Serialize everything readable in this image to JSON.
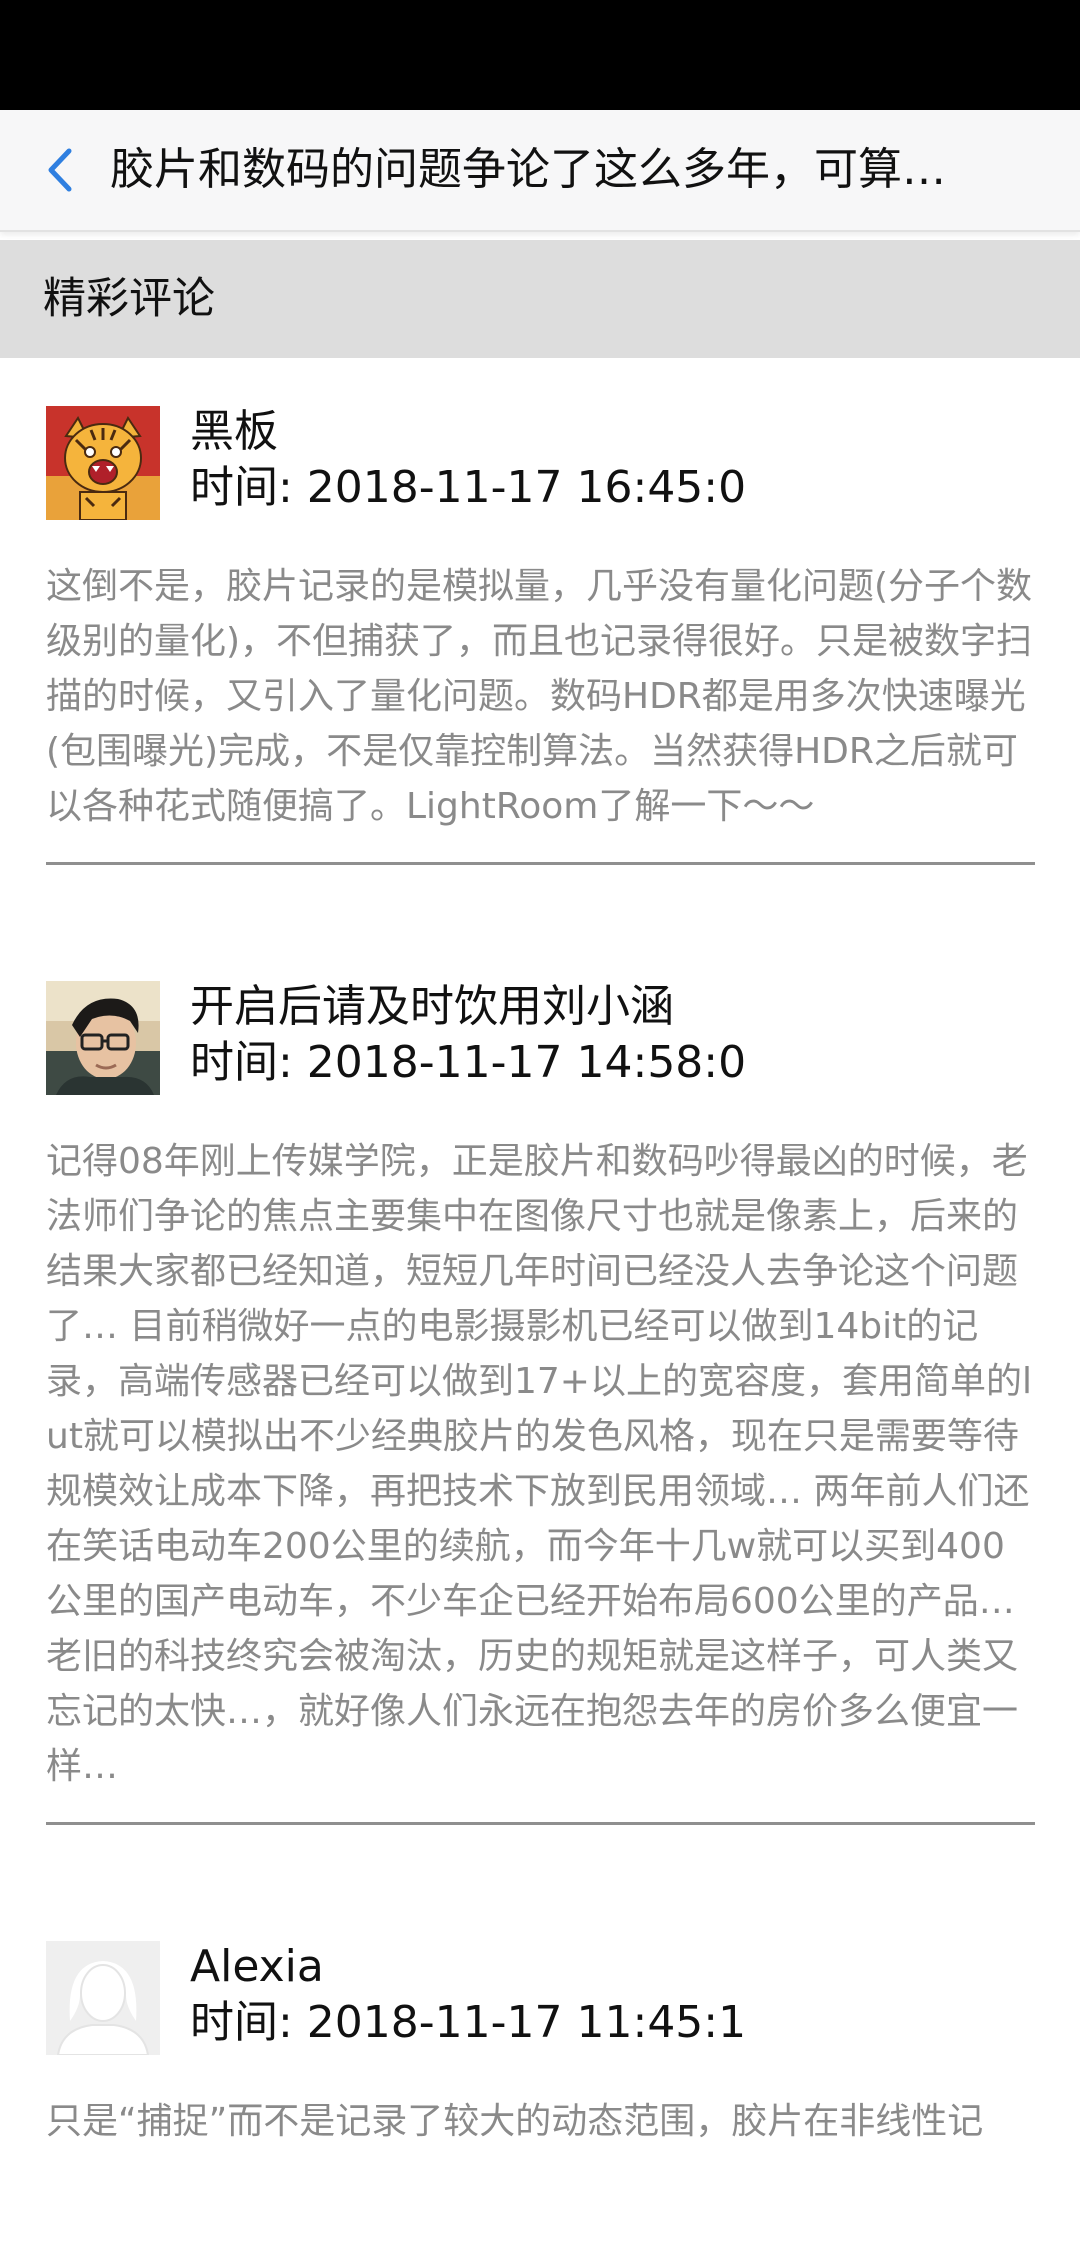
{
  "header": {
    "title": "胶片和数码的问题争论了这么多年，可算…",
    "back_icon": "chevron-left-icon",
    "accent_color": "#2f7fe0"
  },
  "section": {
    "title": "精彩评论"
  },
  "comments": [
    {
      "avatar": "tiger-avatar",
      "user": "黑板",
      "time": "时间: 2018-11-17 16:45:0",
      "body": "这倒不是，胶片记录的是模拟量，几乎没有量化问题(分子个数级别的量化)，不但捕获了，而且也记录得很好。只是被数字扫描的时候，又引入了量化问题。数码HDR都是用多次快速曝光(包围曝光)完成，不是仅靠控制算法。当然获得HDR之后就可以各种花式随便搞了。LightRoom了解一下～～"
    },
    {
      "avatar": "man-with-glasses-avatar",
      "user": "开启后请及时饮用刘小涵",
      "time": "时间: 2018-11-17 14:58:0",
      "body": "记得08年刚上传媒学院，正是胶片和数码吵得最凶的时候，老法师们争论的焦点主要集中在图像尺寸也就是像素上，后来的结果大家都已经知道，短短几年时间已经没人去争论这个问题了… 目前稍微好一点的电影摄影机已经可以做到14bit的记录，高端传感器已经可以做到17+以上的宽容度，套用简单的lut就可以模拟出不少经典胶片的发色风格，现在只是需要等待规模效让成本下降，再把技术下放到民用领域… 两年前人们还在笑话电动车200公里的续航，而今年十几w就可以买到400公里的国产电动车，不少车企已经开始布局600公里的产品… 老旧的科技终究会被淘汰，历史的规矩就是这样子，可人类又忘记的太快…，就好像人们永远在抱怨去年的房价多么便宜一样…"
    },
    {
      "avatar": "default-female-avatar",
      "user": "Alexia",
      "time": "时间: 2018-11-17 11:45:1",
      "body": "只是“捕捉”而不是记录了较大的动态范围，胶片在非线性记"
    }
  ]
}
